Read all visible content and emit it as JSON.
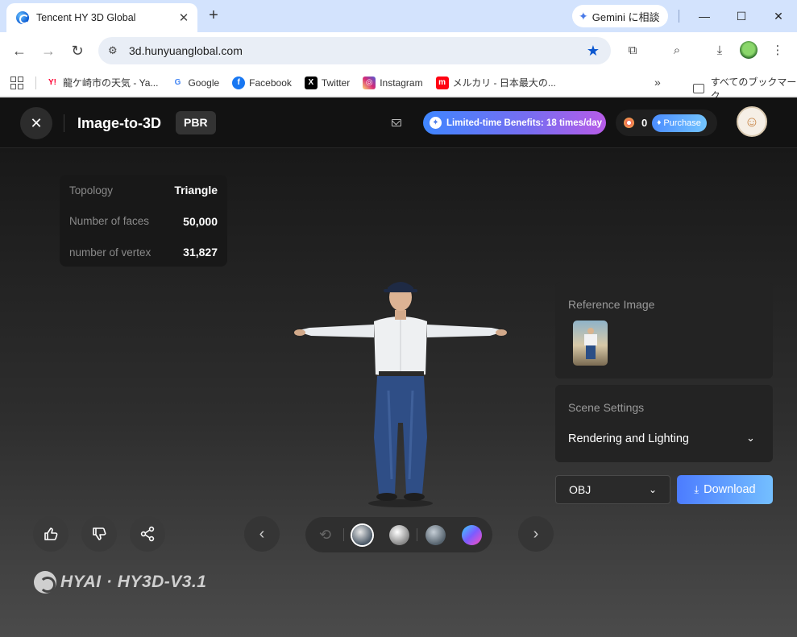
{
  "browser": {
    "tab_title": "Tencent HY 3D Global",
    "tab_close": "✕",
    "new_tab": "+",
    "gemini_label": "Gemini に相談",
    "url": "3d.hunyuanglobal.com",
    "window_controls": {
      "minimize": "—",
      "maximize": "☐",
      "close": "✕"
    },
    "bookmarks": [
      {
        "label": "龍ケ崎市の天気 - Ya...",
        "icon": "yahoo-icon",
        "icon_text": "Y!",
        "color": "#ff0033"
      },
      {
        "label": "Google",
        "icon": "google-icon",
        "icon_text": "G",
        "color": "#4285f4"
      },
      {
        "label": "Facebook",
        "icon": "facebook-icon",
        "icon_text": "f",
        "color": "#1877f2"
      },
      {
        "label": "Twitter",
        "icon": "x-icon",
        "icon_text": "X",
        "color": "#000000"
      },
      {
        "label": "Instagram",
        "icon": "instagram-icon",
        "icon_text": "◎",
        "color": "#d6249f"
      },
      {
        "label": "メルカリ - 日本最大の...",
        "icon": "mercari-icon",
        "icon_text": "m",
        "color": "#ff0211"
      }
    ],
    "bookmarks_more": "»",
    "all_bookmarks": "すべてのブックマーク"
  },
  "app": {
    "close_label": "✕",
    "title": "Image-to-3D",
    "badge": "PBR",
    "benefits": "Limited-time Benefits: 18 times/day",
    "credits": "0",
    "purchase": "Purchase",
    "stats": [
      {
        "label": "Topology",
        "value": "Triangle"
      },
      {
        "label": "Number of faces",
        "value": "50,000"
      },
      {
        "label": "number of vertex",
        "value": "31,827"
      }
    ],
    "reference_image_label": "Reference Image",
    "scene_settings_label": "Scene Settings",
    "scene_settings_value": "Rendering and Lighting",
    "format": "OBJ",
    "download": "Download",
    "prev": "‹",
    "next": "›",
    "brand": "HYAI · HY3D-V3.1",
    "accent": "#4c7cff"
  }
}
